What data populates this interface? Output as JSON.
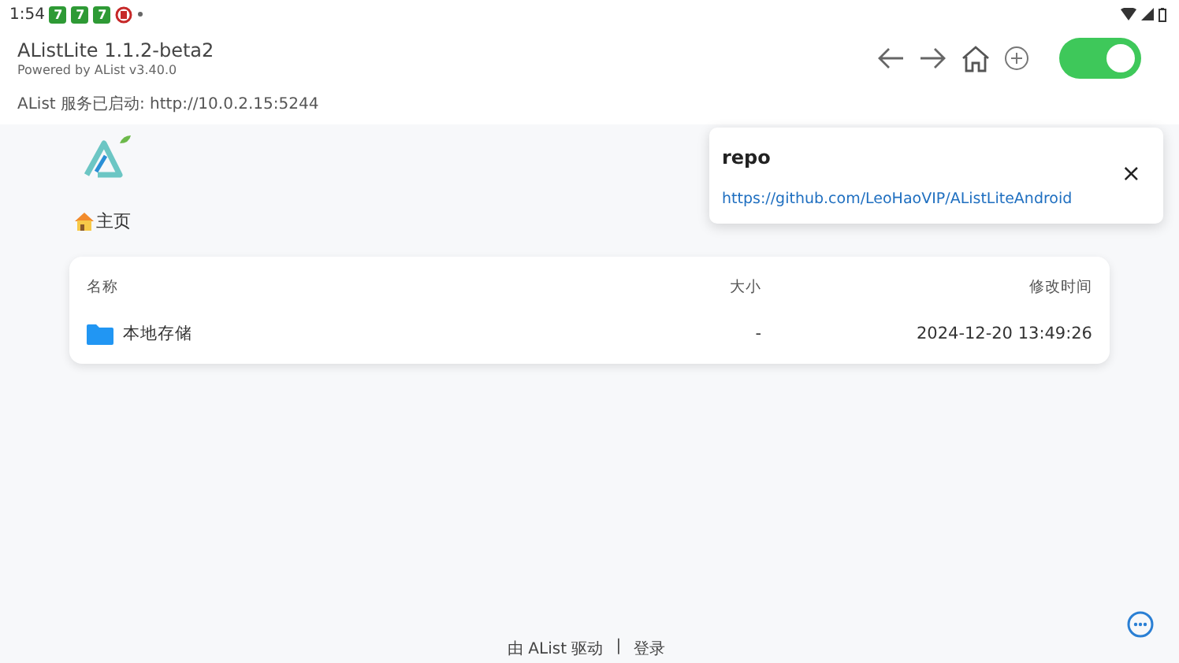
{
  "status_bar": {
    "time": "1:54",
    "notifications": [
      "7",
      "7",
      "7"
    ]
  },
  "header": {
    "title": "AListLite 1.1.2-beta2",
    "subtitle": "Powered by AList v3.40.0",
    "server_status": "AList 服务已启动: http://10.0.2.15:5244",
    "service_switch": {
      "on": true
    }
  },
  "breadcrumb": {
    "label": "主页"
  },
  "table": {
    "columns": [
      "名称",
      "大小",
      "修改时间"
    ],
    "rows": [
      {
        "name": "本地存储",
        "size": "-",
        "modified": "2024-12-20 13:49:26"
      }
    ]
  },
  "popup": {
    "title": "repo",
    "link": "https://github.com/LeoHaoVIP/AListLiteAndroid",
    "close": "×"
  },
  "footer": {
    "powered": "由 AList 驱动",
    "separator": "|",
    "login": "登录"
  }
}
